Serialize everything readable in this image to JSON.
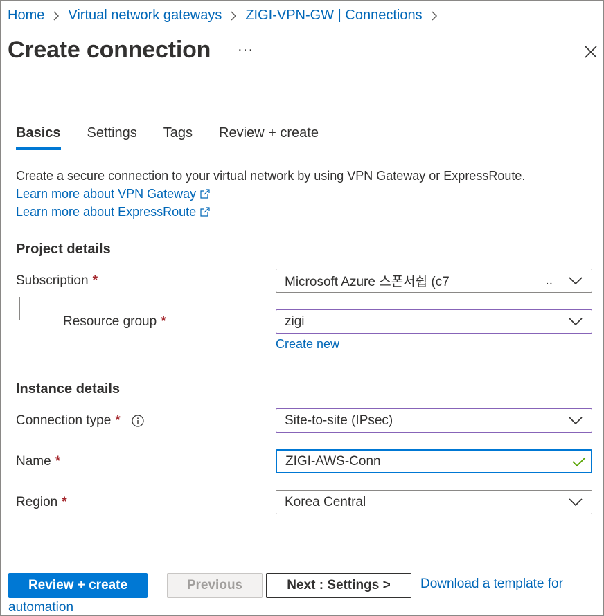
{
  "breadcrumb": {
    "items": [
      "Home",
      "Virtual network gateways",
      "ZIGI-VPN-GW | Connections"
    ]
  },
  "header": {
    "title": "Create connection",
    "more_label": "···",
    "close_icon": "close-icon"
  },
  "tabs": [
    {
      "label": "Basics",
      "active": true
    },
    {
      "label": "Settings",
      "active": false
    },
    {
      "label": "Tags",
      "active": false
    },
    {
      "label": "Review + create",
      "active": false
    }
  ],
  "intro": {
    "description": "Create a secure connection to your virtual network by using VPN Gateway or ExpressRoute.",
    "link_vpn": "Learn more about VPN Gateway",
    "link_expressroute": "Learn more about ExpressRoute"
  },
  "project_details": {
    "title": "Project details",
    "subscription": {
      "label": "Subscription",
      "required": "*",
      "value": "Microsoft Azure 스폰서쉽 (c7",
      "overflow": ".."
    },
    "resource_group": {
      "label": "Resource group",
      "required": "*",
      "value": "zigi",
      "create_new": "Create new"
    }
  },
  "instance_details": {
    "title": "Instance details",
    "connection_type": {
      "label": "Connection type",
      "required": "*",
      "value": "Site-to-site (IPsec)"
    },
    "name": {
      "label": "Name",
      "required": "*",
      "value": "ZIGI-AWS-Conn"
    },
    "region": {
      "label": "Region",
      "required": "*",
      "value": "Korea Central"
    }
  },
  "footer": {
    "review_create": "Review + create",
    "previous": "Previous",
    "next": "Next : Settings >",
    "download_line1": "Download a template for",
    "download_line2": "automation"
  },
  "colors": {
    "accent": "#0078d4",
    "link": "#0067b8",
    "required": "#a4262c",
    "valid": "#57a300",
    "purple_border": "#8764b8"
  }
}
